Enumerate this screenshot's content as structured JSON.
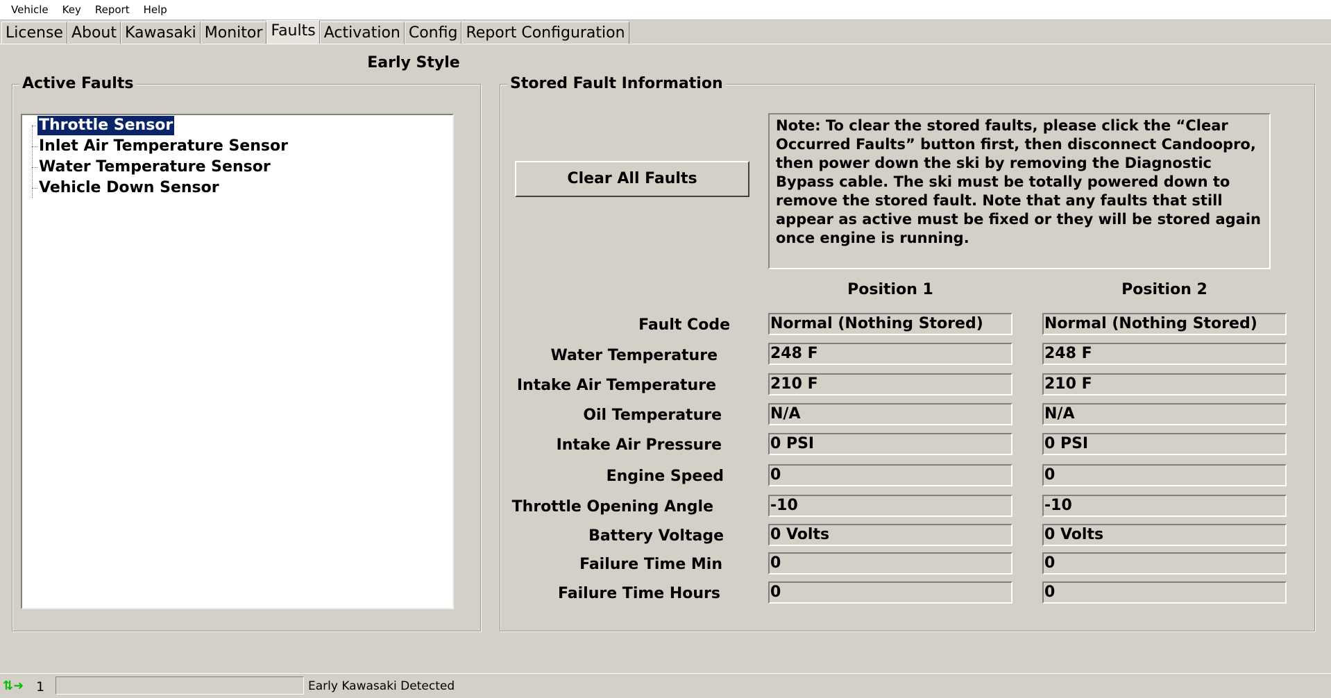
{
  "menu": [
    "Vehicle",
    "Key",
    "Report",
    "Help"
  ],
  "tabs": [
    "License",
    "About",
    "Kawasaki",
    "Monitor",
    "Faults",
    "Activation",
    "Config",
    "Report Configuration"
  ],
  "active_tab": "Faults",
  "style_label": "Early Style",
  "active_faults": {
    "title": "Active Faults",
    "items": [
      "Throttle Sensor",
      "Inlet Air Temperature Sensor",
      "Water Temperature Sensor",
      "Vehicle Down Sensor"
    ],
    "selected": "Throttle Sensor"
  },
  "stored": {
    "title": "Stored Fault Information",
    "clear_button": "Clear All Faults",
    "note": "Note: To clear the stored faults, please click the “Clear Occurred Faults” button first, then disconnect Candoopro, then power down the ski by removing the Diagnostic Bypass cable.  The ski must be totally powered down to remove the stored fault.  Note that any faults that still appear as active must be fixed or they will be stored again once engine is running.",
    "columns": [
      "Position 1",
      "Position 2"
    ],
    "rows": [
      {
        "label": "Fault Code",
        "p1": "Normal (Nothing Stored)",
        "p2": "Normal (Nothing Stored)"
      },
      {
        "label": "Water Temperature",
        "p1": "248 F",
        "p2": "248 F"
      },
      {
        "label": "Intake Air Temperature",
        "p1": "210 F",
        "p2": "210 F"
      },
      {
        "label": "Oil Temperature",
        "p1": "N/A",
        "p2": "N/A"
      },
      {
        "label": "Intake Air Pressure",
        "p1": "0 PSI",
        "p2": "0 PSI"
      },
      {
        "label": "Engine Speed",
        "p1": "0",
        "p2": "0"
      },
      {
        "label": "Throttle Opening Angle",
        "p1": "-10",
        "p2": "-10"
      },
      {
        "label": "Battery Voltage",
        "p1": "0 Volts",
        "p2": "0 Volts"
      },
      {
        "label": "Failure Time Min",
        "p1": "0",
        "p2": "0"
      },
      {
        "label": "Failure Time Hours",
        "p1": "0",
        "p2": "0"
      }
    ]
  },
  "status": {
    "icon": "connection-arrows-icon",
    "number": "1",
    "text": "Early Kawasaki Detected"
  }
}
